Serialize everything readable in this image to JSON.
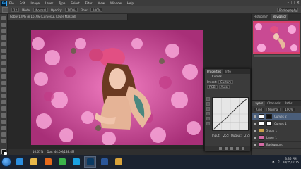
{
  "app": {
    "logo": "Ps"
  },
  "menu": [
    "File",
    "Edit",
    "Image",
    "Layer",
    "Type",
    "Select",
    "Filter",
    "View",
    "Window",
    "Help"
  ],
  "options": {
    "mode_label": "Mode:",
    "mode_value": "Normal",
    "opacity_label": "Opacity:",
    "opacity_value": "100%",
    "flow_label": "Flow:",
    "flow_value": "100%",
    "brush_label": "Brush:",
    "brush_value": "12",
    "workspace": "Photography"
  },
  "document": {
    "tab_title": "hobby1.JPG @ 16.7% (Curves 2, Layer Mask/8)",
    "zoom_status": "16.67%",
    "doc_status": "Doc: 44.0M/138.4M"
  },
  "navigator": {
    "tabs": [
      "Histogram",
      "Navigator"
    ],
    "active": "Navigator"
  },
  "properties": {
    "tabs": [
      "Properties",
      "Info"
    ],
    "title": "Curves",
    "preset_label": "Preset:",
    "preset_value": "Custom",
    "channel_value": "RGB",
    "auto_label": "Auto",
    "input_label": "Input:",
    "input_value": "255",
    "output_label": "Output:",
    "output_value": "255"
  },
  "layers": {
    "tabs": [
      "Layers",
      "Channels",
      "Paths"
    ],
    "kind_label": "Kind",
    "blend_value": "Normal",
    "opacity_value": "100%",
    "rows": [
      {
        "name": "Curves 2",
        "thumb": "dark",
        "selected": true
      },
      {
        "name": "Curves 1",
        "thumb": "white",
        "selected": false
      },
      {
        "name": "Group 1",
        "thumb": "none",
        "selected": false
      },
      {
        "name": "Layer 1",
        "thumb": "img",
        "selected": false
      },
      {
        "name": "Background",
        "thumb": "img",
        "selected": false
      }
    ]
  },
  "taskbar": {
    "apps": [
      {
        "name": "ie-icon",
        "color": "#2b8fe0"
      },
      {
        "name": "explorer-icon",
        "color": "#e7b84a"
      },
      {
        "name": "media-icon",
        "color": "#e56a1c"
      },
      {
        "name": "chrome-icon",
        "color": "#3bb34a"
      },
      {
        "name": "skype-icon",
        "color": "#1aa1e1"
      },
      {
        "name": "photoshop-icon",
        "color": "#0a3a63"
      },
      {
        "name": "word-icon",
        "color": "#2a5699"
      },
      {
        "name": "folder-icon",
        "color": "#d8a23a"
      }
    ],
    "time": "3:36 PM",
    "date": "10/25/2015"
  },
  "colors": {
    "accent": "#31a8ff",
    "selection": "#4a5e7a"
  }
}
